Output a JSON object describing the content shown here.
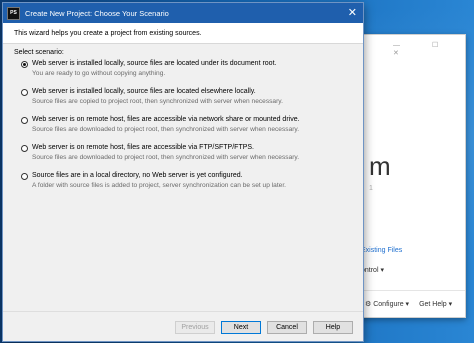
{
  "dialog": {
    "title": "Create New Project: Choose Your Scenario",
    "header_text": "This wizard helps you create a project from existing sources.",
    "select_label": "Select scenario:",
    "options": [
      {
        "label": "Web server is installed locally, source files are located under its document root.",
        "desc": "You are ready to go without copying anything.",
        "selected": true
      },
      {
        "label": "Web server is installed locally, source files are located elsewhere locally.",
        "desc": "Source files are copied to project root, then synchronized with server when necessary.",
        "selected": false
      },
      {
        "label": "Web server is on remote host, files are accessible via network share or mounted drive.",
        "desc": "Source files are downloaded to project root, then synchronized with server when necessary.",
        "selected": false
      },
      {
        "label": "Web server is on remote host, files are accessible via FTP/SFTP/FTPS.",
        "desc": "Source files are downloaded to project root, then synchronized with server when necessary.",
        "selected": false
      },
      {
        "label": "Source files are in a local directory, no Web server is yet configured.",
        "desc": "A folder with source files is added to project, server synchronization can be set up later.",
        "selected": false
      }
    ],
    "buttons": {
      "previous": "Previous",
      "next": "Next",
      "cancel": "Cancel",
      "help": "Help"
    }
  },
  "background_window": {
    "big_text": "m",
    "link": "Existing Files",
    "control": "ontrol",
    "configure": "Configure",
    "get_help": "Get Help"
  }
}
